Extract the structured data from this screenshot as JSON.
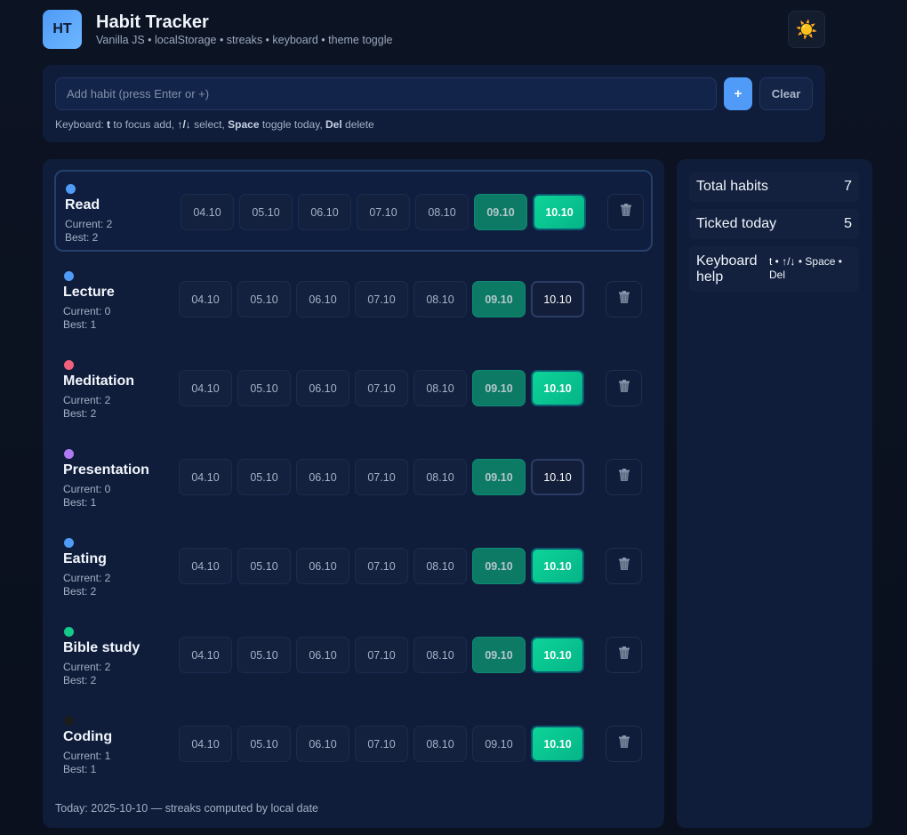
{
  "header": {
    "logo_text": "HT",
    "title": "Habit Tracker",
    "subtitle": "Vanilla JS • localStorage • streaks • keyboard • theme toggle",
    "theme_icon": "☀️"
  },
  "add": {
    "placeholder": "Add habit (press Enter or +)",
    "plus_label": "+",
    "clear_label": "Clear"
  },
  "keyboard_hint": {
    "prefix": "Keyboard: ",
    "k1": "t",
    "t1": " to focus add, ",
    "k2": "↑/↓",
    "t2": " select, ",
    "k3": "Space",
    "t3": " toggle today, ",
    "k4": "Del",
    "t4": " delete"
  },
  "days": [
    "04.10",
    "05.10",
    "06.10",
    "07.10",
    "08.10",
    "09.10",
    "10.10"
  ],
  "colors": {
    "accent": "#4f9bf7",
    "ticked_past": "#0d7a66",
    "ticked_today": "#0dd498"
  },
  "habits": [
    {
      "name": "Read",
      "current": "Current: 2",
      "best": "Best: 2",
      "color": "#4f9bf7",
      "ticked": [
        false,
        false,
        false,
        false,
        false,
        true,
        true
      ],
      "selected": true
    },
    {
      "name": "Lecture",
      "current": "Current: 0",
      "best": "Best: 1",
      "color": "#4f9bf7",
      "ticked": [
        false,
        false,
        false,
        false,
        false,
        true,
        false
      ],
      "selected": false
    },
    {
      "name": "Meditation",
      "current": "Current: 2",
      "best": "Best: 2",
      "color": "#f0607a",
      "ticked": [
        false,
        false,
        false,
        false,
        false,
        true,
        true
      ],
      "selected": false
    },
    {
      "name": "Presentation",
      "current": "Current: 0",
      "best": "Best: 1",
      "color": "#b07af2",
      "ticked": [
        false,
        false,
        false,
        false,
        false,
        true,
        false
      ],
      "selected": false
    },
    {
      "name": "Eating",
      "current": "Current: 2",
      "best": "Best: 2",
      "color": "#4f9bf7",
      "ticked": [
        false,
        false,
        false,
        false,
        false,
        true,
        true
      ],
      "selected": false
    },
    {
      "name": "Bible study",
      "current": "Current: 2",
      "best": "Best: 2",
      "color": "#14c98a",
      "ticked": [
        false,
        false,
        false,
        false,
        false,
        true,
        true
      ],
      "selected": false
    },
    {
      "name": "Coding",
      "current": "Current: 1",
      "best": "Best: 1",
      "color": "#1c1c1c",
      "ticked": [
        false,
        false,
        false,
        false,
        false,
        false,
        true
      ],
      "selected": false
    }
  ],
  "footer": "Today: 2025-10-10 — streaks computed by local date",
  "stats": {
    "total_label": "Total habits",
    "total_value": "7",
    "today_label": "Ticked today",
    "today_value": "5",
    "help_label_1": "Keyboard",
    "help_label_2": "help",
    "help_value": "t • ↑/↓ • Space • Del"
  }
}
